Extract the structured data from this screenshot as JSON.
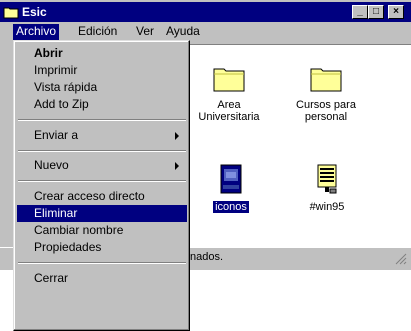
{
  "window": {
    "title": "Esic",
    "controls": {
      "minimize": "_",
      "maximize": "□",
      "close": "×"
    }
  },
  "menubar": {
    "items": [
      {
        "label": "Archivo",
        "active": true
      },
      {
        "label": "Edición",
        "active": false
      },
      {
        "label": "Ver",
        "active": false
      },
      {
        "label": "Ayuda",
        "active": false
      }
    ]
  },
  "folders": [
    {
      "label_line1": "Area",
      "label_line2": "Universitaria",
      "icon": "folder-icon"
    },
    {
      "label_line1": "Cursos para",
      "label_line2": "personal",
      "icon": "folder-icon"
    },
    {
      "label_line1": "iconos",
      "label_line2": "",
      "icon": "image-file-icon",
      "selected": true
    },
    {
      "label_line1": "#win95",
      "label_line2": "",
      "icon": "config-file-icon"
    }
  ],
  "statusbar": {
    "text": "nados."
  },
  "file_menu": {
    "items": [
      {
        "label": "Abrir",
        "bold": true
      },
      {
        "label": "Imprimir"
      },
      {
        "label": "Vista rápida"
      },
      {
        "label": "Add to Zip"
      },
      {
        "label": "Enviar a",
        "submenu": true
      },
      {
        "label": "Nuevo",
        "submenu": true
      },
      {
        "label": "Crear acceso directo"
      },
      {
        "label": "Eliminar",
        "highlighted": true
      },
      {
        "label": "Cambiar nombre"
      },
      {
        "label": "Propiedades"
      },
      {
        "label": "Cerrar"
      }
    ]
  },
  "colors": {
    "titlebar": "#000080",
    "face": "#c0c0c0",
    "highlight": "#000080",
    "folder": "#ffff99"
  }
}
